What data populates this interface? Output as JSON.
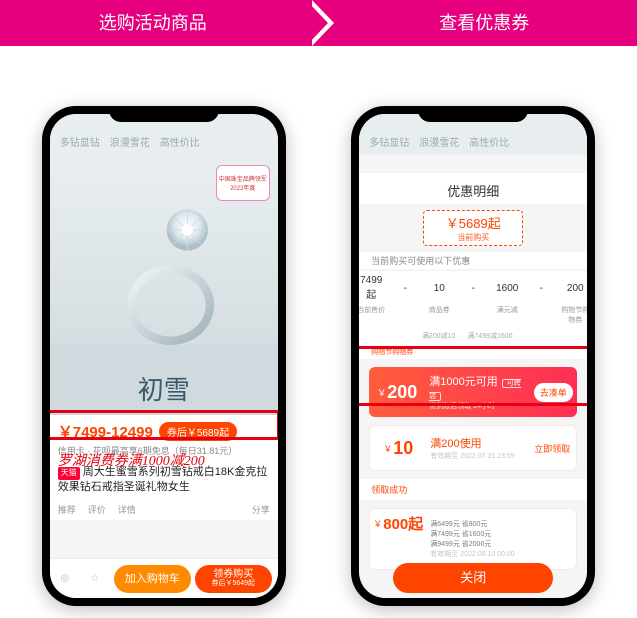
{
  "steps": [
    "选购活动商品",
    "查看优惠券"
  ],
  "left": {
    "tabs": [
      "多钻显钻",
      "浪漫雪花",
      "高性价比"
    ],
    "cert_badge": "中国珠宝品牌领军\n2022年度",
    "pedestal": "初雪",
    "price_range": "￥7499-12499",
    "coupon_price": "券后￥5689起",
    "installment": "信用卡 · 花呗最高享6期免息（每日31.81元）",
    "annotation": "罗湖消费券满1000减200",
    "title": "周大生蜜雪系列初雪钻戒白18K金克拉效果钻石戒指圣诞礼物女生",
    "tmall_tag": "天猫",
    "meta": [
      "推荐",
      "评价",
      "详情"
    ],
    "share_label": "分享",
    "bottom": {
      "cart": "加入购物车",
      "buy_main": "领券购买",
      "buy_sub": "券后￥5649起"
    }
  },
  "right": {
    "tabs": [
      "多钻显钻",
      "浪漫雪花",
      "高性价比"
    ],
    "head": "优惠明细",
    "price": "￥5689起",
    "price_sub": "当前购买",
    "hint": "当前购买可使用以下优惠",
    "calc": {
      "a": "7499起",
      "op1": "-",
      "b": "10",
      "op2": "-",
      "c": "1600",
      "op3": "-",
      "d": "200"
    },
    "calc_labels": [
      "当前售价",
      "商品券",
      "满元减",
      "购物节购物券"
    ],
    "sub_labels": [
      "满200减10",
      "满7499减1600",
      ""
    ],
    "coupon_tag": "购物节购物券",
    "coupon_main": {
      "amount": "200",
      "title": "满1000元可用",
      "sub": "需到账后领取 24小时",
      "cross": "可跨店",
      "action": "去凑单"
    },
    "coupon_small": {
      "amount": "10",
      "title": "满200使用",
      "sub": "有效期至 2022.07.31 23:59",
      "action": "立即领取"
    },
    "link": "领取成功",
    "coupon_big": {
      "amount": "800起",
      "lines": [
        "满6499元 省800元",
        "满7499元 省1600元",
        "满9499元 省2000元"
      ],
      "sub": "有效期至 2022.08.10 00:00"
    },
    "close": "关闭"
  }
}
